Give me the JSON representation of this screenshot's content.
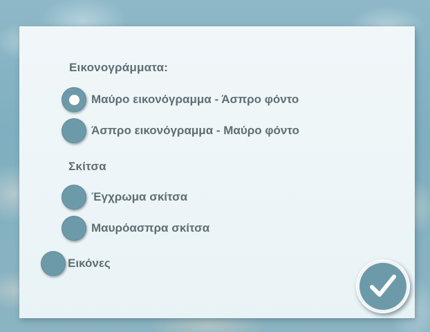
{
  "settings": {
    "pictograms": {
      "heading": "Εικονογράμματα:",
      "options": [
        {
          "label": "Μαύρο εικονόγραμμα - Άσπρο φόντο",
          "selected": true
        },
        {
          "label": "Άσπρο εικονόγραμμα - Μαύρο φόντο",
          "selected": false
        }
      ]
    },
    "sketches": {
      "heading": "Σκίτσα",
      "options": [
        {
          "label": "Έγχρωμα σκίτσα",
          "selected": false
        },
        {
          "label": "Μαυρόασπρα σκίτσα",
          "selected": false
        }
      ]
    },
    "images": {
      "label": "Εικόνες",
      "selected": false
    }
  },
  "confirm_icon": "checkmark-icon",
  "colors": {
    "accent": "#6d9aa8",
    "text": "#5e6e75",
    "panel": "#eef5f8"
  }
}
